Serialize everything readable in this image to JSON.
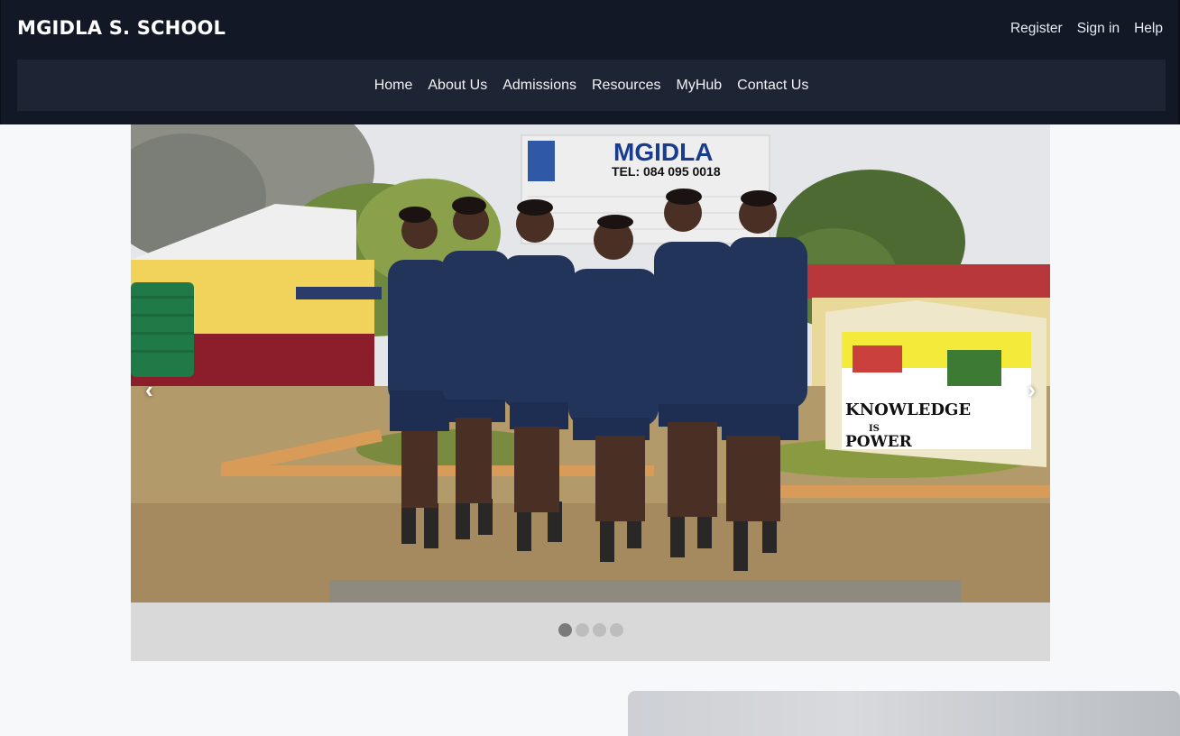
{
  "brand": {
    "name": "MGIDLA S. SCHOOL"
  },
  "top_links": [
    "Register",
    "Sign in",
    "Help"
  ],
  "nav": [
    "Home",
    "About Us",
    "Admissions",
    "Resources",
    "MyHub",
    "Contact Us"
  ],
  "carousel": {
    "prev_arrow": "‹",
    "next_arrow": "›",
    "slide_count": 4,
    "active_index": 0,
    "slide": {
      "board_school_name": "MGIDLA",
      "board_tel": "TEL: 084 095 0018",
      "sign_line1": "KNOWLEDGE",
      "sign_line2": "IS",
      "sign_line3": "POWER"
    }
  },
  "colors": {
    "header_bg": "#121826",
    "nav_bg": "#1d2433",
    "blazer": "#22345a",
    "building_yellow": "#f1d25b",
    "building_red": "#8b1e2a"
  }
}
